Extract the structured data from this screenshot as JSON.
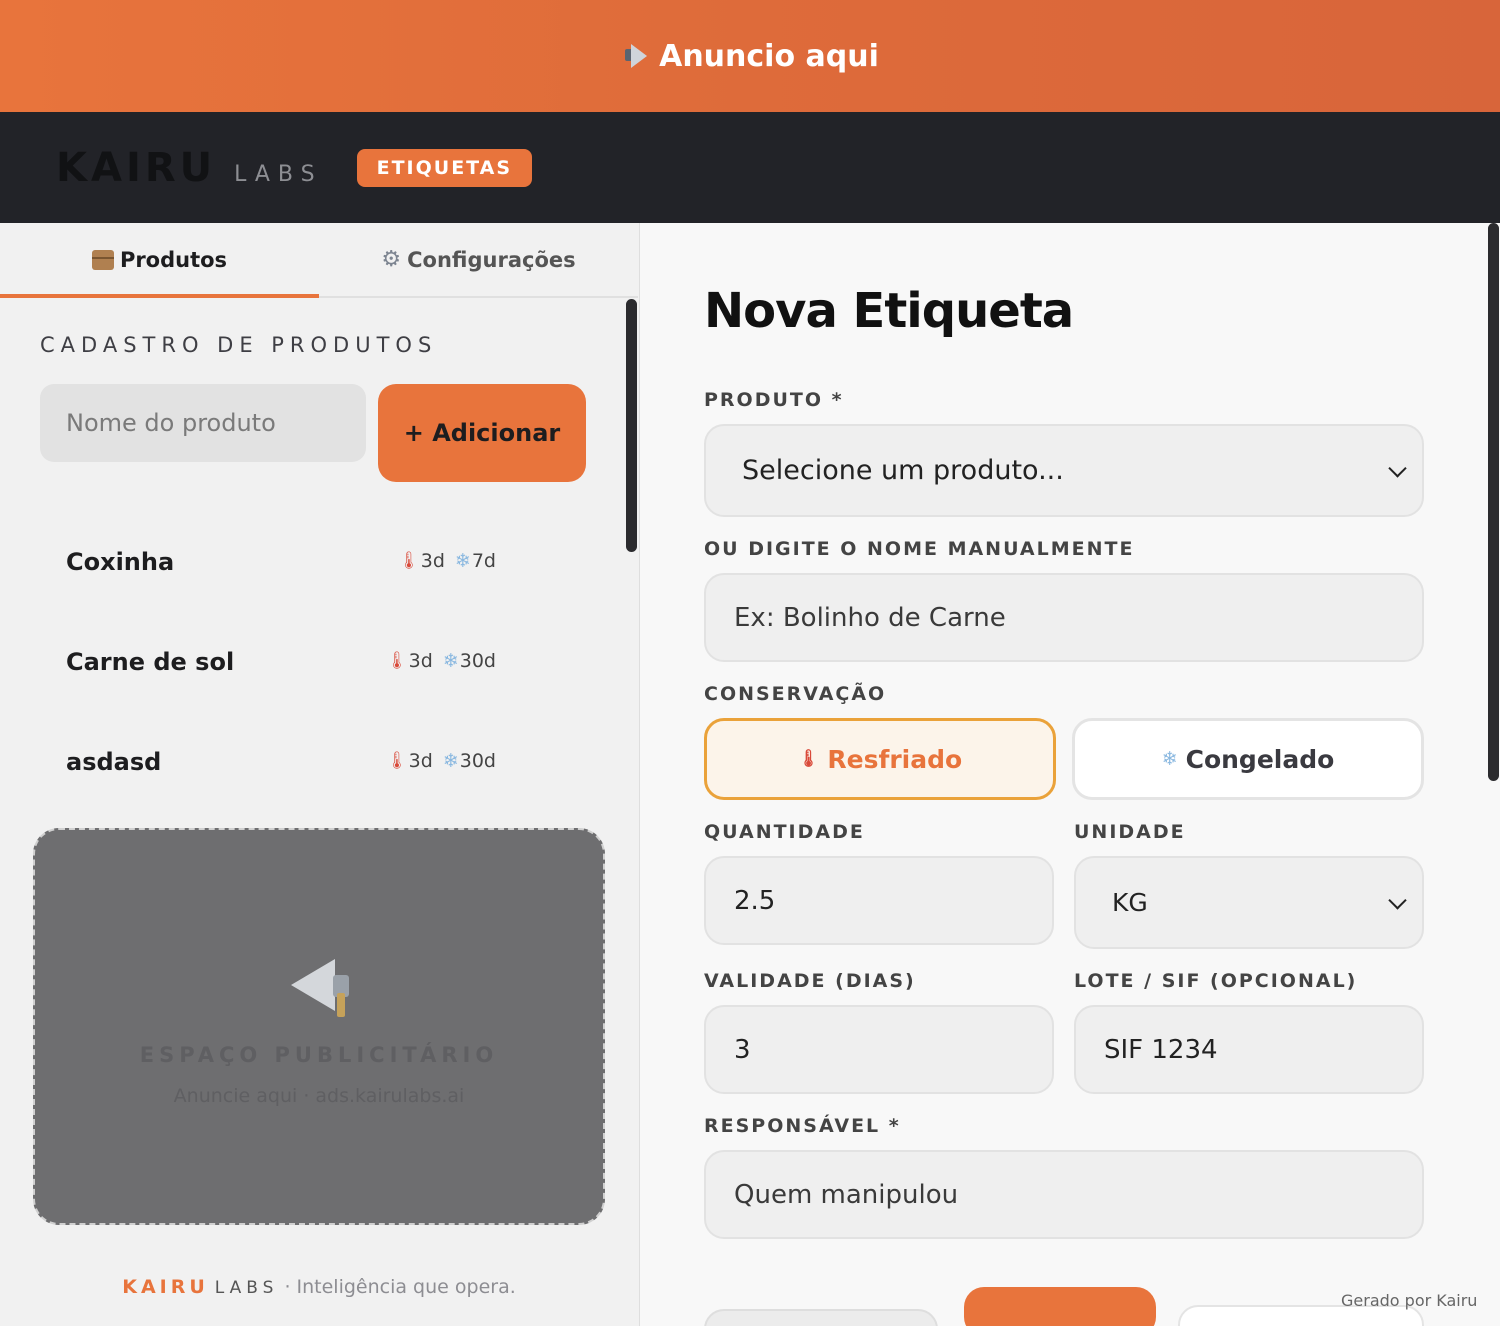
{
  "banner": {
    "text": "Anuncio aqui",
    "icon": "megaphone-icon"
  },
  "header": {
    "brand": "KAIRU",
    "brand_suffix": "LABS",
    "badge": "ETIQUETAS"
  },
  "left": {
    "tabs": [
      {
        "label": "Produtos",
        "icon": "package-icon",
        "active": true
      },
      {
        "label": "Configurações",
        "icon": "gear-icon",
        "active": false
      }
    ],
    "section_title": "CADASTRO DE PRODUTOS",
    "product_input": {
      "placeholder": "Nome do produto",
      "value": ""
    },
    "add_button": "+ Adicionar",
    "products": [
      {
        "name": "Coxinha",
        "chilled": "3d",
        "frozen": "7d"
      },
      {
        "name": "Carne de sol",
        "chilled": "3d",
        "frozen": "30d"
      },
      {
        "name": "asdasd",
        "chilled": "3d",
        "frozen": "30d"
      }
    ],
    "ad": {
      "title": "ESPAÇO PUBLICITÁRIO",
      "subtitle": "Anuncie aqui · ads.kairulabs.ai"
    },
    "footer": {
      "brand": "KAIRU",
      "brand_suffix": "LABS",
      "tagline": "· Inteligência que opera."
    }
  },
  "form": {
    "title": "Nova Etiqueta",
    "product_label": "PRODUTO *",
    "product_select": "Selecione um produto...",
    "manual_label": "OU DIGITE O NOME MANUALMENTE",
    "manual_placeholder": "Ex: Bolinho de Carne",
    "conservation_label": "CONSERVAÇÃO",
    "conservation_options": [
      {
        "label": "Resfriado",
        "selected": true
      },
      {
        "label": "Congelado",
        "selected": false
      }
    ],
    "quantity_label": "QUANTIDADE",
    "quantity_value": "2.5",
    "unit_label": "UNIDADE",
    "unit_value": "KG",
    "validity_label": "VALIDADE (DIAS)",
    "validity_value": "3",
    "lot_label": "LOTE / SIF (OPCIONAL)",
    "lot_value": "SIF 1234",
    "responsible_label": "RESPONSÁVEL *",
    "responsible_placeholder": "Quem manipulou",
    "generated_by": "Gerado por Kairu"
  },
  "colors": {
    "accent": "#e8743c",
    "header_bg": "#222328",
    "selected_border": "#eaa23a"
  }
}
